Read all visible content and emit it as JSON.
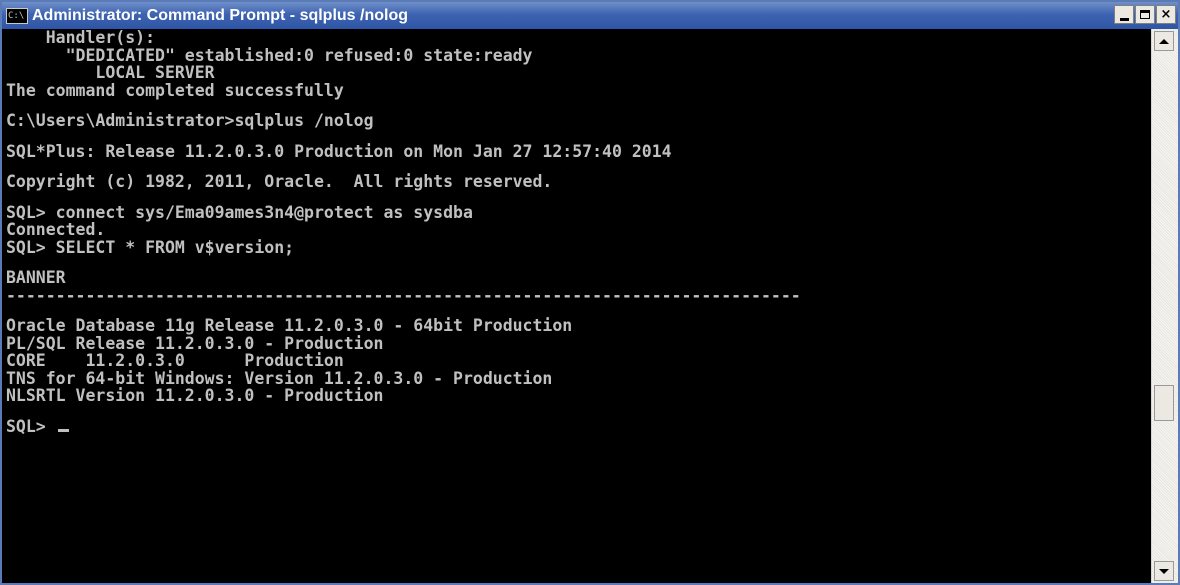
{
  "window": {
    "title": "Administrator: Command Prompt - sqlplus  /nolog",
    "icon": "cmd-icon",
    "icon_text": "C:\\",
    "buttons": {
      "minimize": "minimize",
      "maximize": "maximize",
      "close": "×"
    }
  },
  "console": {
    "lines": [
      "    Handler(s):",
      "      \"DEDICATED\" established:0 refused:0 state:ready",
      "         LOCAL SERVER",
      "The command completed successfully",
      "",
      "C:\\Users\\Administrator>sqlplus /nolog",
      "",
      "SQL*Plus: Release 11.2.0.3.0 Production on Mon Jan 27 12:57:40 2014",
      "",
      "Copyright (c) 1982, 2011, Oracle.  All rights reserved.",
      "",
      "SQL> connect sys/Ema09ames3n4@protect as sysdba",
      "Connected.",
      "SQL> SELECT * FROM v$version;",
      "",
      "BANNER",
      "--------------------------------------------------------------------------------",
      "",
      "Oracle Database 11g Release 11.2.0.3.0 - 64bit Production",
      "PL/SQL Release 11.2.0.3.0 - Production",
      "CORE    11.2.0.3.0      Production",
      "TNS for 64-bit Windows: Version 11.2.0.3.0 - Production",
      "NLSRTL Version 11.2.0.3.0 - Production",
      "",
      "SQL> "
    ]
  },
  "colors": {
    "titlebar": "#3e64b0",
    "console_bg": "#000000",
    "console_fg": "#c0c0c0"
  }
}
